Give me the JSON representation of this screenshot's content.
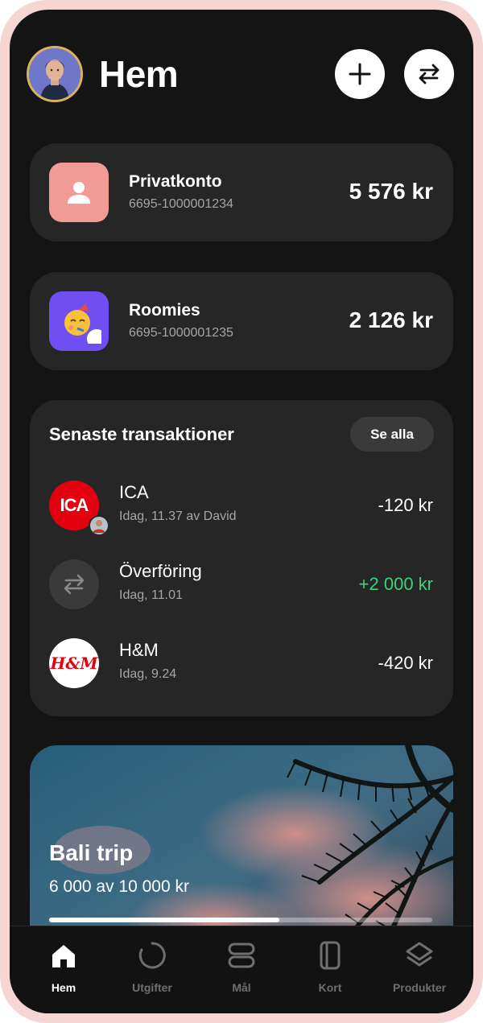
{
  "header": {
    "title": "Hem"
  },
  "accounts": [
    {
      "name": "Privatkonto",
      "number": "6695-1000001234",
      "balance": "5 576 kr",
      "icon": "person-icon",
      "color": "#f19a96"
    },
    {
      "name": "Roomies",
      "number": "6695-1000001235",
      "balance": "2 126 kr",
      "icon": "party-face-icon",
      "color": "#6f4ef2"
    }
  ],
  "transactions": {
    "title": "Senaste transaktioner",
    "see_all": "Se alla",
    "items": [
      {
        "name": "ICA",
        "sub": "Idag, 11.37 av David",
        "amount": "-120 kr",
        "logo_text": "ICA",
        "color": "#e3000f"
      },
      {
        "name": "Överföring",
        "sub": "Idag, 11.01",
        "amount": "+2 000 kr",
        "amount_color": "#3ad37a",
        "icon": "transfer-icon"
      },
      {
        "name": "H&M",
        "sub": "Idag, 9.24",
        "amount": "-420 kr",
        "logo_text": "H&M",
        "color": "#e50010"
      }
    ]
  },
  "goal": {
    "title": "Bali trip",
    "progress_text": "6 000 av 10 000 kr",
    "progress": 0.6
  },
  "nav": {
    "items": [
      {
        "label": "Hem",
        "icon": "home-icon",
        "active": true
      },
      {
        "label": "Utgifter",
        "icon": "spending-ring-icon",
        "active": false
      },
      {
        "label": "Mål",
        "icon": "goals-stack-icon",
        "active": false
      },
      {
        "label": "Kort",
        "icon": "card-icon",
        "active": false
      },
      {
        "label": "Produkter",
        "icon": "layers-icon",
        "active": false
      }
    ]
  }
}
